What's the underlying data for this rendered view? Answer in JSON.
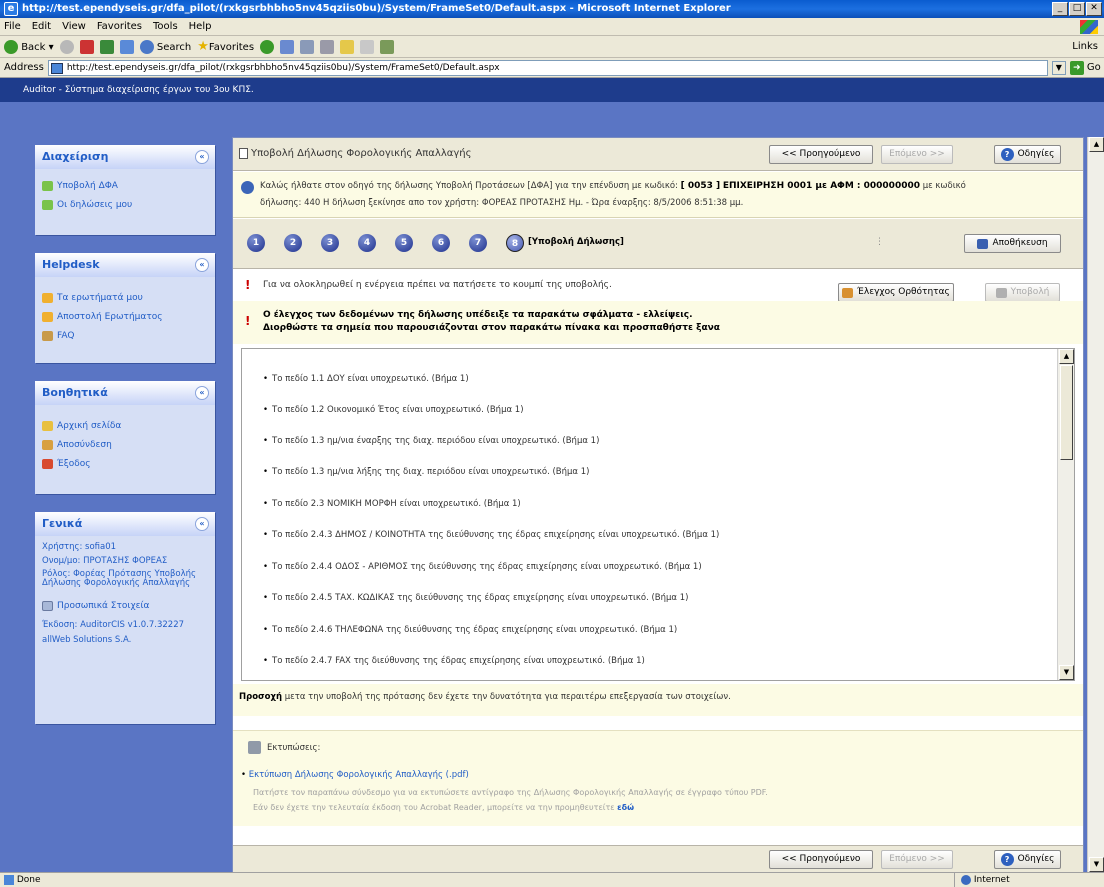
{
  "window": {
    "title": "http://test.ependyseis.gr/dfa_pilot/(rxkgsrbhbho5nv45qziis0bu)/System/FrameSet0/Default.aspx - Microsoft Internet Explorer"
  },
  "menu": [
    "File",
    "Edit",
    "View",
    "Favorites",
    "Tools",
    "Help"
  ],
  "toolbar": {
    "back": "Back",
    "search": "Search",
    "favorites": "Favorites",
    "links": "Links"
  },
  "address": {
    "label": "Address",
    "url": "http://test.ependyseis.gr/dfa_pilot/(rxkgsrbhbho5nv45qziis0bu)/System/FrameSet0/Default.aspx",
    "go": "Go"
  },
  "app_header": "Auditor - Σύστημα διαχείρισης έργων του 3ου ΚΠΣ.",
  "sidebar": {
    "admin": {
      "title": "Διαχείριση",
      "items": [
        "Υποβολή ΔΦΑ",
        "Οι δηλώσεις μου"
      ]
    },
    "helpdesk": {
      "title": "Helpdesk",
      "items": [
        "Τα ερωτήματά μου",
        "Αποστολή Ερωτήματος",
        "FAQ"
      ]
    },
    "aux": {
      "title": "Βοηθητικά",
      "items": [
        "Αρχική σελίδα",
        "Αποσύνδεση",
        "Έξοδος"
      ]
    },
    "general": {
      "title": "Γενικά",
      "user": "Χρήστης: sofia01",
      "name": "Ονομ/μο: ΠΡΟΤΑΣΗΣ ΦΟΡΕΑΣ",
      "role": "Ρόλος: Φορέας Πρότασης Υποβολής Δήλωσης Φορολογικής Απαλλαγής",
      "personal": "Προσωπικά Στοιχεία",
      "version": "Έκδοση: AuditorCIS v1.0.7.32227",
      "company": "allWeb Solutions S.A."
    }
  },
  "main": {
    "title": "Υποβολή Δήλωσης Φορολογικής Απαλλαγής",
    "prev": "<< Προηγούμενο",
    "next": "Επόμενο >>",
    "help": "Οδηγίες",
    "welcome_a": "Καλώς ήλθατε στον οδηγό της δήλωσης Υποβολή Προτάσεων [ΔΦΑ] για την επένδυση με κωδικό:",
    "code": "[ 0053 ]",
    "company": "ΕΠΙΧΕΙΡΗΣΗ 0001 με ΑΦΜ : 000000000",
    "welcome_b": "με κωδικό",
    "welcome_c": "δήλωσης: 440 Η δήλωση ξεκίνησε απο τον χρήστη: ΦΟΡΕΑΣ ΠΡΟΤΑΣΗΣ Ημ. - Ώρα έναρξης: 8/5/2006 8:51:38 μμ.",
    "steps": [
      "1",
      "2",
      "3",
      "4",
      "5",
      "6",
      "7",
      "8"
    ],
    "step_label": "[Υποβολή Δήλωσης]",
    "save": "Αποθήκευση",
    "msg_submit": "Για να ολοκληρωθεί η ενέργεια πρέπει να πατήσετε το κουμπί της υποβολής.",
    "check": "Έλεγχος Ορθότητας",
    "submit": "Υποβολή",
    "err_title_1": "Ο έλεγχος των δεδομένων της δήλωσης υπέδειξε τα παρακάτω σφάλματα - ελλείψεις.",
    "err_title_2": "Διορθώστε τα σημεία που παρουσιάζονται στον παρακάτω πίνακα και προσπαθήστε ξανα",
    "errors": [
      "Το πεδίο 1.1 ΔΟΥ είναι υποχρεωτικό. (Βήμα 1)",
      "Το πεδίο 1.2 Οικονομικό Έτος είναι υποχρεωτικό. (Βήμα 1)",
      "Το πεδίο 1.3 ημ/νια έναρξης της διαχ. περιόδου είναι υποχρεωτικό. (Βήμα 1)",
      "Το πεδίο 1.3 ημ/νια λήξης της διαχ. περιόδου είναι υποχρεωτικό. (Βήμα 1)",
      "Το πεδίο 2.3 ΝΟΜΙΚΗ ΜΟΡΦΗ είναι υποχρεωτικό. (Βήμα 1)",
      "Το πεδίο 2.4.3 ΔΗΜΟΣ / ΚΟΙΝΟΤΗΤΑ της διεύθυνσης της έδρας επιχείρησης είναι υποχρεωτικό. (Βήμα 1)",
      "Το πεδίο 2.4.4 ΟΔΟΣ - ΑΡΙΘΜΟΣ της διεύθυνσης της έδρας επιχείρησης είναι υποχρεωτικό. (Βήμα 1)",
      "Το πεδίο 2.4.5 ΤΑΧ. ΚΩΔΙΚΑΣ της διεύθυνσης της έδρας επιχείρησης είναι υποχρεωτικό. (Βήμα 1)",
      "Το πεδίο 2.4.6 ΤΗΛΕΦΩΝΑ της διεύθυνσης της έδρας επιχείρησης είναι υποχρεωτικό. (Βήμα 1)",
      "Το πεδίο 2.4.7 FAX της διεύθυνσης της έδρας επιχείρησης είναι υποχρεωτικό. (Βήμα 1)"
    ],
    "note_bold": "Προσοχή",
    "note_text": " μετα την υποβολή της πρότασης δεν έχετε την δυνατότητα για περαιτέρω επεξεργασία των στοιχείων.",
    "prints_title": "Εκτυπώσεις:",
    "print_link": "Εκτύπωση Δήλωσης Φορολογικής Απαλλαγής (.pdf)",
    "print_desc_1": "Πατήστε τον παραπάνω σύνδεσμο για να εκτυπώσετε αντίγραφο της Δήλωσης Φορολογικής Απαλλαγής σε έγγραφο τύπου PDF.",
    "print_desc_2": "Εάν δεν έχετε την τελευταία έκδοση του Acrobat Reader, μπορείτε να την προμηθευτείτε",
    "print_here": "εδώ"
  },
  "status": {
    "left": "Done",
    "zone": "Internet"
  }
}
